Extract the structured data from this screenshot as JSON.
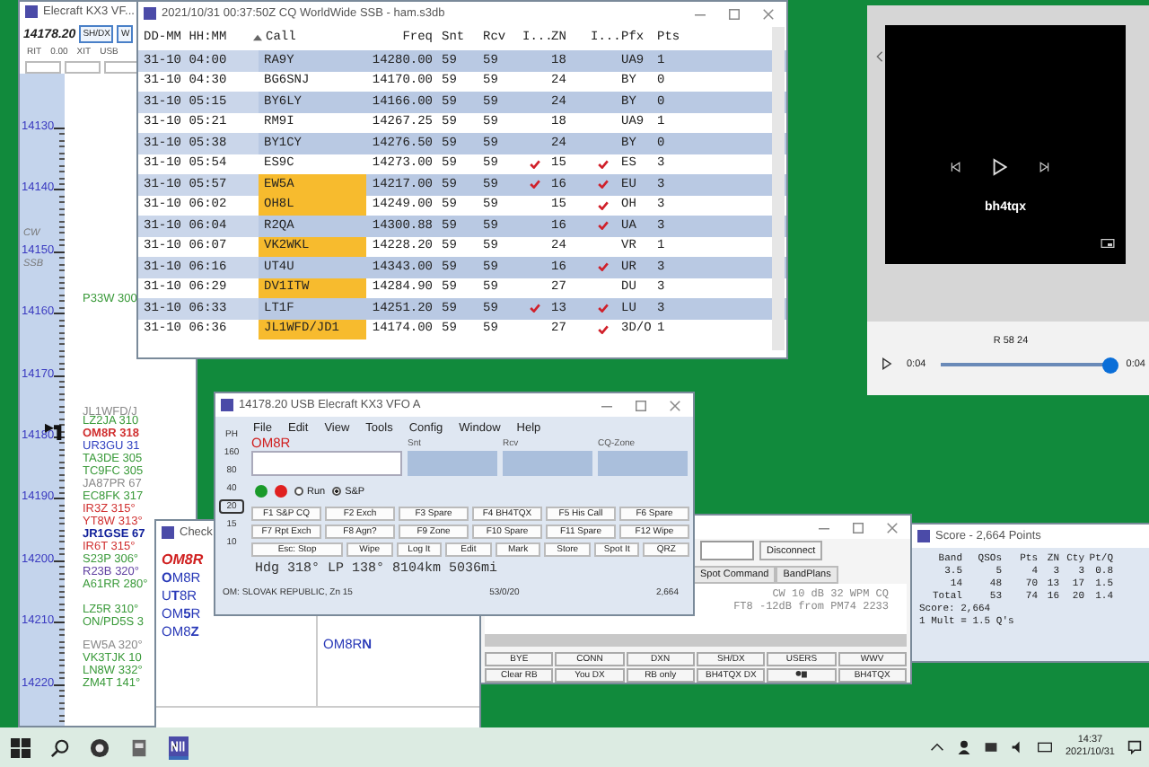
{
  "bandmap": {
    "title": "Elecraft KX3 VF...",
    "frequency": "14178.20",
    "button": "SH/DX",
    "button_2": "W",
    "status": [
      "RIT",
      "0.00",
      "XIT",
      "USB"
    ],
    "segments": [
      "CW",
      "SSB"
    ],
    "ticks": [
      "14130",
      "14140",
      "14150",
      "14160",
      "14170",
      "14180",
      "14190",
      "14200",
      "14210",
      "14220"
    ],
    "spots": [
      {
        "text": "P33W 300",
        "color": "#3a9a3a",
        "bold": false
      },
      {
        "text": "JL1WFD/J",
        "color": "#8a8a8a",
        "bold": false
      },
      {
        "text": "LZ2JA 310",
        "color": "#3a9a3a",
        "bold": false
      },
      {
        "text": "OM8R 318",
        "color": "#d03030",
        "bold": true
      },
      {
        "text": "UR3GU 31",
        "color": "#3040c0",
        "bold": false
      },
      {
        "text": "TA3DE 305",
        "color": "#3a9a3a",
        "bold": false
      },
      {
        "text": "TC9FC 305",
        "color": "#3a9a3a",
        "bold": false
      },
      {
        "text": "JA87PR 67",
        "color": "#8a8a8a",
        "bold": false
      },
      {
        "text": "EC8FK 317",
        "color": "#3a9a3a",
        "bold": false
      },
      {
        "text": "IR3Z 315°",
        "color": "#d03030",
        "bold": false
      },
      {
        "text": "YT8W 313°",
        "color": "#d03030",
        "bold": false
      },
      {
        "text": "JR1GSE 67",
        "color": "#10209a",
        "bold": true
      },
      {
        "text": "IR6T 315°",
        "color": "#d03030",
        "bold": false
      },
      {
        "text": "S23P 306°",
        "color": "#3a9a3a",
        "bold": false
      },
      {
        "text": "R23B 320°",
        "color": "#6040a0",
        "bold": false
      },
      {
        "text": "A61RR 280°",
        "color": "#3a9a3a",
        "bold": false
      },
      {
        "text": "LZ5R 310°",
        "color": "#3a9a3a",
        "bold": false
      },
      {
        "text": "ON/PD5S 3",
        "color": "#3a9a3a",
        "bold": false
      },
      {
        "text": "EW5A 320°",
        "color": "#8a8a8a",
        "bold": false
      },
      {
        "text": "VK3TJK 10",
        "color": "#3a9a3a",
        "bold": false
      },
      {
        "text": "LN8W 332°",
        "color": "#3a9a3a",
        "bold": false
      },
      {
        "text": "ZM4T 141°",
        "color": "#3a9a3a",
        "bold": false
      }
    ]
  },
  "log": {
    "title": "2021/10/31 00:37:50Z  CQ WorldWide SSB - ham.s3db",
    "columns": [
      "DD-MM HH:MM",
      "Call",
      "Freq",
      "Snt",
      "Rcv",
      "I...",
      "ZN",
      "I...",
      "Pfx",
      "Pts"
    ],
    "rows": [
      {
        "datetime": "31-10 04:00",
        "call": "RA9Y",
        "freq": "14280.00",
        "snt": "59",
        "rcv": "59",
        "check_1": false,
        "zn": "18",
        "check_2": false,
        "pfx": "UA9",
        "pts": "1",
        "flagged": false
      },
      {
        "datetime": "31-10 04:30",
        "call": "BG6SNJ",
        "freq": "14170.00",
        "snt": "59",
        "rcv": "59",
        "check_1": false,
        "zn": "24",
        "check_2": false,
        "pfx": "BY",
        "pts": "0",
        "flagged": false
      },
      {
        "datetime": "31-10 05:15",
        "call": "BY6LY",
        "freq": "14166.00",
        "snt": "59",
        "rcv": "59",
        "check_1": false,
        "zn": "24",
        "check_2": false,
        "pfx": "BY",
        "pts": "0",
        "flagged": false
      },
      {
        "datetime": "31-10 05:21",
        "call": "RM9I",
        "freq": "14267.25",
        "snt": "59",
        "rcv": "59",
        "check_1": false,
        "zn": "18",
        "check_2": false,
        "pfx": "UA9",
        "pts": "1",
        "flagged": false
      },
      {
        "datetime": "31-10 05:38",
        "call": "BY1CY",
        "freq": "14276.50",
        "snt": "59",
        "rcv": "59",
        "check_1": false,
        "zn": "24",
        "check_2": false,
        "pfx": "BY",
        "pts": "0",
        "flagged": false
      },
      {
        "datetime": "31-10 05:54",
        "call": "ES9C",
        "freq": "14273.00",
        "snt": "59",
        "rcv": "59",
        "check_1": true,
        "zn": "15",
        "check_2": true,
        "pfx": "ES",
        "pts": "3",
        "flagged": false
      },
      {
        "datetime": "31-10 05:57",
        "call": "EW5A",
        "freq": "14217.00",
        "snt": "59",
        "rcv": "59",
        "check_1": true,
        "zn": "16",
        "check_2": true,
        "pfx": "EU",
        "pts": "3",
        "flagged": true
      },
      {
        "datetime": "31-10 06:02",
        "call": "OH8L",
        "freq": "14249.00",
        "snt": "59",
        "rcv": "59",
        "check_1": false,
        "zn": "15",
        "check_2": true,
        "pfx": "OH",
        "pts": "3",
        "flagged": true
      },
      {
        "datetime": "31-10 06:04",
        "call": "R2QA",
        "freq": "14300.88",
        "snt": "59",
        "rcv": "59",
        "check_1": false,
        "zn": "16",
        "check_2": true,
        "pfx": "UA",
        "pts": "3",
        "flagged": false
      },
      {
        "datetime": "31-10 06:07",
        "call": "VK2WKL",
        "freq": "14228.20",
        "snt": "59",
        "rcv": "59",
        "check_1": false,
        "zn": "24",
        "check_2": false,
        "pfx": "VR",
        "pts": "1",
        "flagged": true
      },
      {
        "datetime": "31-10 06:16",
        "call": "UT4U",
        "freq": "14343.00",
        "snt": "59",
        "rcv": "59",
        "check_1": false,
        "zn": "16",
        "check_2": true,
        "pfx": "UR",
        "pts": "3",
        "flagged": false
      },
      {
        "datetime": "31-10 06:29",
        "call": "DV1ITW",
        "freq": "14284.90",
        "snt": "59",
        "rcv": "59",
        "check_1": false,
        "zn": "27",
        "check_2": false,
        "pfx": "DU",
        "pts": "3",
        "flagged": true
      },
      {
        "datetime": "31-10 06:33",
        "call": "LT1F",
        "freq": "14251.20",
        "snt": "59",
        "rcv": "59",
        "check_1": true,
        "zn": "13",
        "check_2": true,
        "pfx": "LU",
        "pts": "3",
        "flagged": false
      },
      {
        "datetime": "31-10 06:36",
        "call": "JL1WFD/JD1",
        "freq": "14174.00",
        "snt": "59",
        "rcv": "59",
        "check_1": false,
        "zn": "27",
        "check_2": true,
        "pfx": "3D/O",
        "pts": "1",
        "flagged": true
      }
    ]
  },
  "check": {
    "title": "Check",
    "call": "OM8R",
    "matches": [
      "**O**M8R",
      "U**T**8R",
      "OM**5**R",
      "OM8**Z**"
    ],
    "matches_2": [
      "OM8R**N**"
    ]
  },
  "spots_window": {
    "button": "Disconnect",
    "tabs": [
      "Spot Command",
      "BandPlans"
    ],
    "lines": [
      "CW 10 dB 32 WPM CQ",
      "FT8 -12dB from PM74 2233"
    ],
    "buttons": [
      {
        "kind": "text",
        "label": "BYE"
      },
      {
        "kind": "text",
        "label": "CONN"
      },
      {
        "kind": "text",
        "label": "DXN"
      },
      {
        "kind": "text",
        "label": "SH/DX"
      },
      {
        "kind": "text",
        "label": "USERS"
      },
      {
        "kind": "text",
        "label": "WWV"
      },
      {
        "kind": "text",
        "label": "Clear RB"
      },
      {
        "kind": "text",
        "label": "You DX"
      },
      {
        "kind": "text",
        "label": "RB only"
      },
      {
        "kind": "text",
        "label": "BH4TQX DX"
      },
      {
        "kind": "icon"
      },
      {
        "kind": "text",
        "label": "BH4TQX"
      }
    ]
  },
  "entry": {
    "title": "14178.20 USB Elecraft KX3 VFO A",
    "menu": [
      "File",
      "Edit",
      "View",
      "Tools",
      "Config",
      "Window",
      "Help"
    ],
    "bands": [
      {
        "label": "PH",
        "selected": false
      },
      {
        "label": "160",
        "selected": false
      },
      {
        "label": "80",
        "selected": false
      },
      {
        "label": "40",
        "selected": false
      },
      {
        "label": "20",
        "selected": true
      },
      {
        "label": "15",
        "selected": false
      },
      {
        "label": "10",
        "selected": false
      }
    ],
    "call_status": "OM8R",
    "fields": [
      "Snt",
      "Rcv",
      "CQ-Zone"
    ],
    "radios": [
      {
        "label": "Run",
        "selected": false
      },
      {
        "label": "S&P",
        "selected": true
      }
    ],
    "function_keys": [
      [
        "F1 S&P CQ",
        "F2 Exch",
        "F3 Spare",
        "F4 BH4TQX",
        "F5 His Call",
        "F6 Spare"
      ],
      [
        "F7 Rpt Exch",
        "F8 Agn?",
        "F9 Zone",
        "F10 Spare",
        "F11 Spare",
        "F12 Wipe"
      ],
      [
        "Esc: Stop",
        "Wipe",
        "Log It",
        "Edit",
        "Mark",
        "Store",
        "Spot It",
        "QRZ"
      ]
    ],
    "info": "Hdg 318° LP 138° 8104km 5036mi",
    "status": [
      "OM: SLOVAK REPUBLIC, Zn 15",
      "53/0/20",
      "2,664"
    ]
  },
  "score": {
    "title": "Score - 2,664 Points",
    "columns": [
      "Band",
      "QSOs",
      "Pts",
      "ZN",
      "Cty",
      "Pt/Q"
    ],
    "rows": [
      [
        "3.5",
        "5",
        "4",
        "3",
        "3",
        "0.8"
      ],
      [
        "14",
        "48",
        "70",
        "13",
        "17",
        "1.5"
      ],
      [
        "Total",
        "53",
        "74",
        "16",
        "20",
        "1.4"
      ]
    ],
    "lines": [
      "Score: 2,664",
      "1 Mult = 1.5 Q's"
    ]
  },
  "player": {
    "caption": "bh4tqx",
    "track": "R 58 24",
    "elapsed": "0:04",
    "total": "0:04",
    "level": 1.0
  },
  "taskbar": {
    "time": "14:37",
    "date": "2021/10/31"
  }
}
